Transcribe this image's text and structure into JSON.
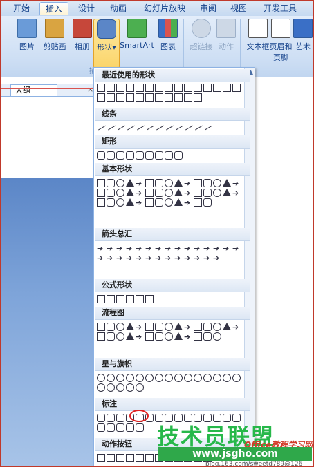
{
  "tabs": [
    "开始",
    "插入",
    "设计",
    "动画",
    "幻灯片放映",
    "审阅",
    "视图",
    "开发工具"
  ],
  "active_tab": "插入",
  "ribbon": {
    "buttons": [
      {
        "label": "图片",
        "color": "#6a9bd8"
      },
      {
        "label": "剪贴画",
        "color": "#d9a441"
      },
      {
        "label": "相册",
        "color": "#c6473a"
      },
      {
        "label": "形状",
        "color": "#5b86c7"
      },
      {
        "label": "SmartArt",
        "color": "#4caf50"
      },
      {
        "label": "图表",
        "color": "#3a6fc6"
      },
      {
        "label": "超链接",
        "color": "#9db0c9"
      },
      {
        "label": "动作",
        "color": "#9db0c9"
      },
      {
        "label": "文本框",
        "color": "#ffffff"
      },
      {
        "label": "页眉和页脚",
        "color": "#ffffff"
      },
      {
        "label": "艺术",
        "color": "#3a6fc6"
      }
    ],
    "group_label": "插"
  },
  "pane": {
    "tab_label": "大纲",
    "close": "×"
  },
  "shapes_menu": {
    "sections": [
      {
        "title": "最近使用的形状",
        "count": 26
      },
      {
        "title": "线条",
        "count": 12
      },
      {
        "title": "矩形",
        "count": 9
      },
      {
        "title": "基本形状",
        "count": 42
      },
      {
        "title": "箭头总汇",
        "count": 28
      },
      {
        "title": "公式形状",
        "count": 6
      },
      {
        "title": "流程图",
        "count": 28
      },
      {
        "title": "星与旗帜",
        "count": 20
      },
      {
        "title": "标注",
        "count": 20
      },
      {
        "title": "动作按钮",
        "count": 12
      }
    ]
  },
  "watermark": {
    "main": "技术员联盟",
    "url": "www.jsgho.com",
    "tag": "Office教程学习网",
    "small": "blog.163.com/sweetd789@126"
  }
}
